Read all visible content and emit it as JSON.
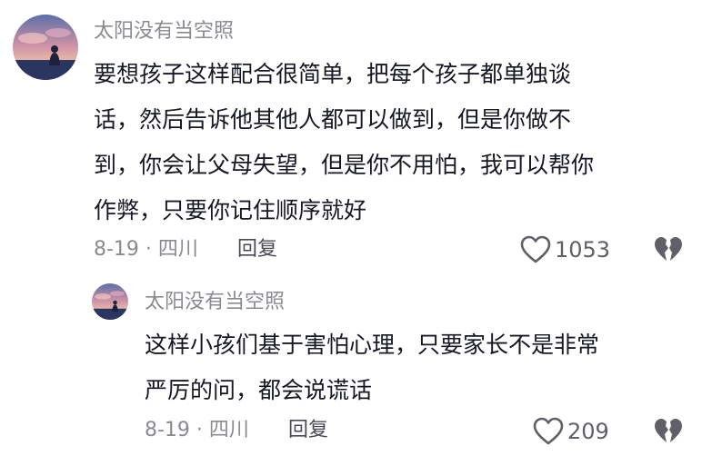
{
  "comments": [
    {
      "username": "太阳没有当空照",
      "content_lines": [
        "要想孩子这样配合很简单，把每个孩子都单独谈",
        "话，然后告诉他其他人都可以做到，但是你做不",
        "到，你会让父母失望，但是你不用怕，我可以帮你",
        "作弊，只要你记住顺序就好"
      ],
      "date_location": "8-19 · 四川",
      "reply_label": "回复",
      "like_count": "1053"
    },
    {
      "username": "太阳没有当空照",
      "content_lines": [
        "这样小孩们基于害怕心理，只要家长不是非常",
        "严厉的问，都会说谎话"
      ],
      "date_location": "8-19 · 四川",
      "reply_label": "回复",
      "like_count": "209"
    }
  ],
  "icons": {
    "like": "heart-outline-icon",
    "dislike": "broken-heart-icon",
    "avatar": "sunset-silhouette-avatar"
  },
  "colors": {
    "text_primary": "#161823",
    "text_secondary": "#8a8b91",
    "icon": "#5f6068"
  }
}
